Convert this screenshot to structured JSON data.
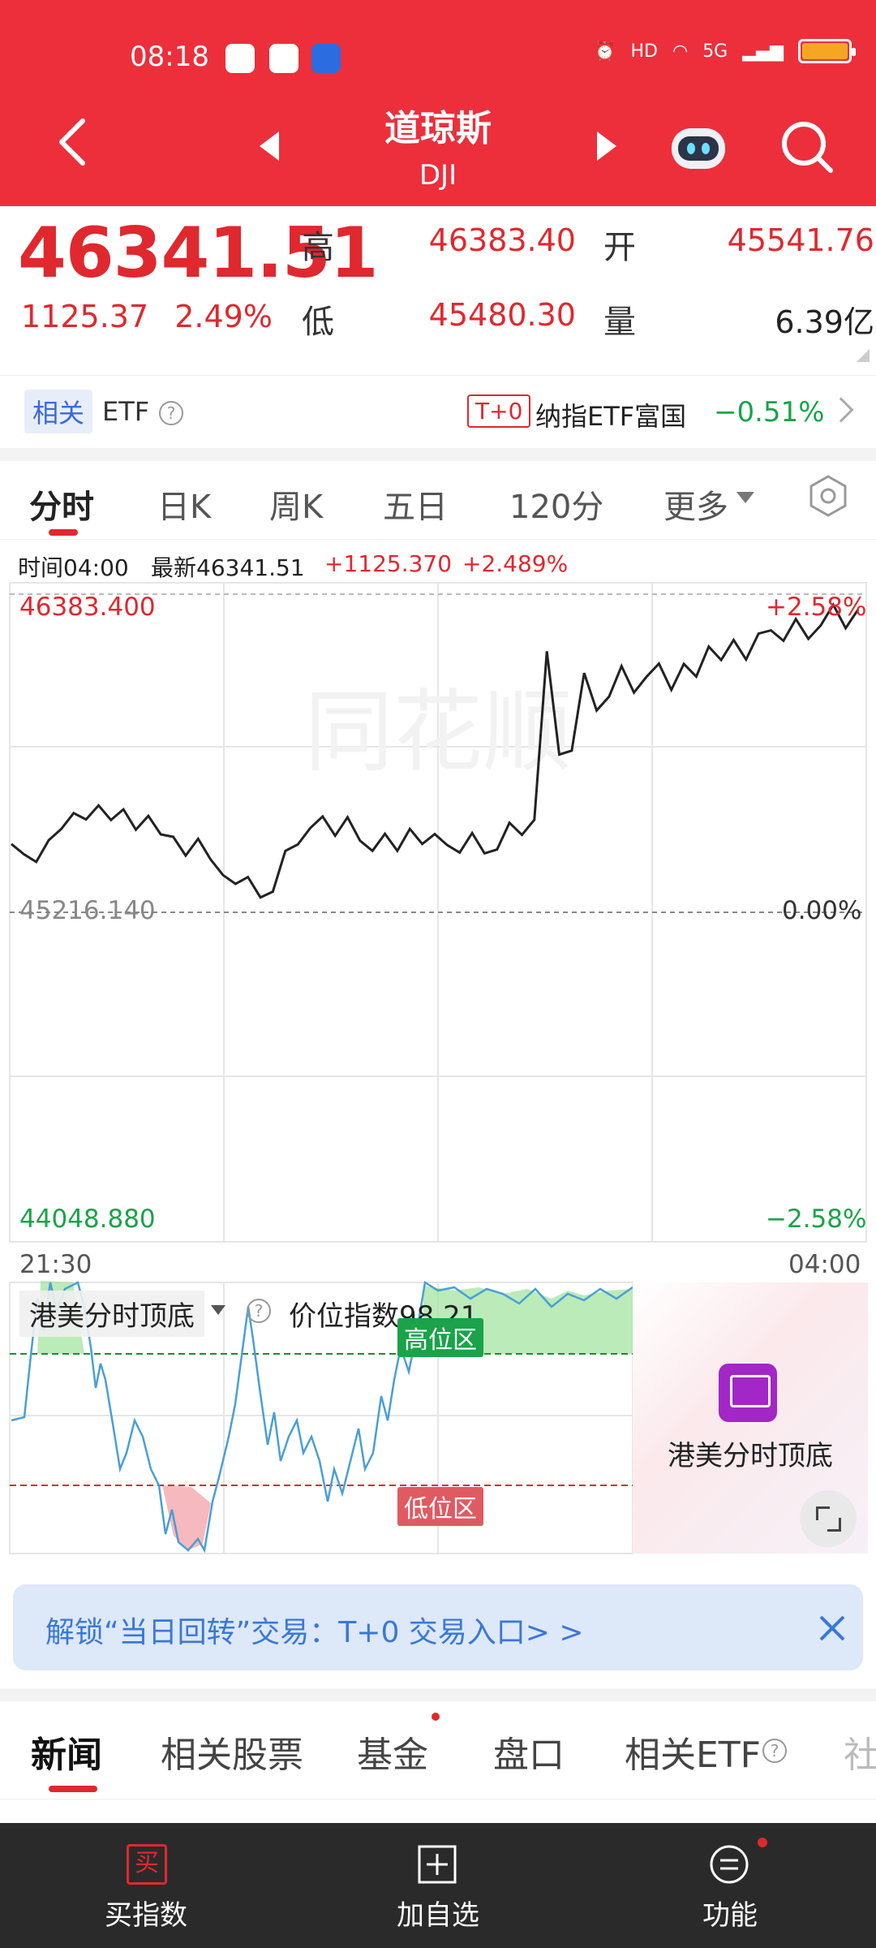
{
  "status_bar": {
    "time": "08:18",
    "net": "5G"
  },
  "header": {
    "title": "道琼斯",
    "code": "DJI"
  },
  "quote": {
    "last": "46341.51",
    "change": "1125.37",
    "change_pct": "2.49%",
    "high_label": "高",
    "high": "46383.40",
    "open_label": "开",
    "open": "45541.76",
    "low_label": "低",
    "low": "45480.30",
    "vol_label": "量",
    "volume": "6.39亿"
  },
  "etf_row": {
    "tag": "相关",
    "label": "ETF",
    "t0": "T+0",
    "name": "纳指ETF富国",
    "change": "−0.51%"
  },
  "tabs": [
    "分时",
    "日K",
    "周K",
    "五日",
    "120分",
    "更多"
  ],
  "info": {
    "time": "时间04:00",
    "latest": "最新46341.51",
    "chg": "+1125.370",
    "pct": "+2.489%"
  },
  "chart_data": {
    "type": "line",
    "y_high": "46383.400",
    "y_mid": "45216.140",
    "y_low": "44048.880",
    "pct_high": "+2.58%",
    "pct_mid": "0.00%",
    "pct_low": "−2.58%",
    "time_start": "21:30",
    "time_end": "04:00",
    "ylim": [
      44048.88,
      46383.4
    ],
    "x_start": "21:30",
    "x_end": "04:00",
    "values": [
      45476,
      45439,
      45411,
      45490,
      45530,
      45588,
      45565,
      45616,
      45563,
      45602,
      45528,
      45578,
      45511,
      45502,
      45434,
      45495,
      45420,
      45363,
      45331,
      45356,
      45282,
      45303,
      45451,
      45474,
      45534,
      45576,
      45506,
      45573,
      45488,
      45451,
      45513,
      45451,
      45531,
      45476,
      45512,
      45472,
      45445,
      45516,
      45442,
      45456,
      45553,
      45509,
      45564,
      46176,
      45801,
      45815,
      46097,
      45961,
      46011,
      46122,
      46026,
      46083,
      46131,
      46036,
      46130,
      46084,
      46193,
      46144,
      46217,
      46146,
      46240,
      46252,
      46214,
      46293,
      46221,
      46270,
      46345,
      46260,
      46328
    ]
  },
  "indicator": {
    "name": "港美分时顶底",
    "value": "价位指数98.21",
    "high_zone": "高位区",
    "low_zone": "低位区",
    "promo": "港美分时顶底"
  },
  "banner": {
    "text": "解锁“当日回转”交易：T+0 交易入口> >"
  },
  "news_tabs": [
    "新闻",
    "相关股票",
    "基金",
    "盘口",
    "相关ETF",
    "社"
  ],
  "bottom_bar": {
    "buy": "买指数",
    "buy_icon_char": "买",
    "add": "加自选",
    "func": "功能"
  },
  "colors": {
    "up": "#e0282f",
    "down": "#1aa34a",
    "header": "#ec2f3b"
  }
}
